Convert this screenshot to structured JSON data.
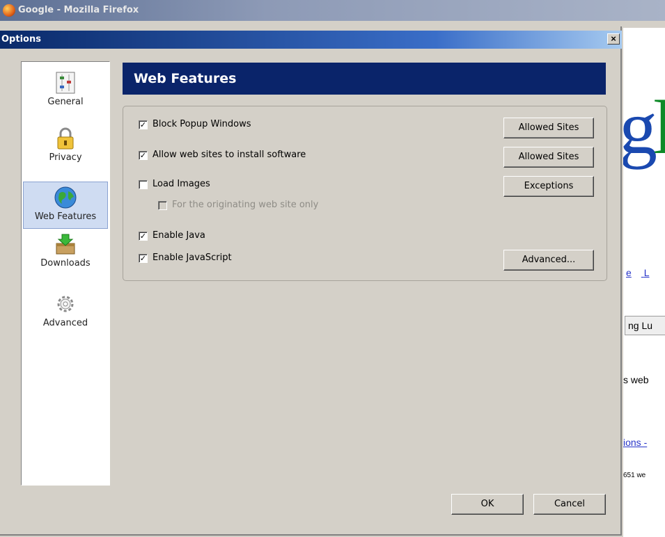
{
  "browser": {
    "window_title": "Google - Mozilla Firefox"
  },
  "background_page": {
    "links": [
      "e",
      "L"
    ],
    "button_text": "ng Lu",
    "text_web": "s web",
    "link_ions": "ions -",
    "small_text": "651 we"
  },
  "dialog": {
    "title": "Options",
    "close_glyph": "×"
  },
  "sidebar": {
    "items": [
      {
        "label": "General",
        "icon": "general-settings-icon",
        "selected": false
      },
      {
        "label": "Privacy",
        "icon": "padlock-icon",
        "selected": false
      },
      {
        "label": "Web Features",
        "icon": "globe-icon",
        "selected": true
      },
      {
        "label": "Downloads",
        "icon": "download-box-icon",
        "selected": false
      },
      {
        "label": "Advanced",
        "icon": "gear-icon",
        "selected": false
      }
    ]
  },
  "panel": {
    "header": "Web Features",
    "options": [
      {
        "label": "Block Popup Windows",
        "checked": true,
        "disabled": false,
        "button": "Allowed Sites"
      },
      {
        "label": "Allow web sites to install software",
        "checked": true,
        "disabled": false,
        "button": "Allowed Sites"
      },
      {
        "label": "Load Images",
        "checked": false,
        "disabled": false,
        "button": "Exceptions"
      },
      {
        "label": "For the originating web site only",
        "checked": false,
        "disabled": true,
        "button": ""
      },
      {
        "label": "Enable Java",
        "checked": true,
        "disabled": false,
        "button": ""
      },
      {
        "label": "Enable JavaScript",
        "checked": true,
        "disabled": false,
        "button": "Advanced..."
      }
    ]
  },
  "footer": {
    "ok_label": "OK",
    "cancel_label": "Cancel"
  },
  "colors": {
    "header_bg": "#0a246a",
    "selected_bg": "#cfdcf2",
    "dialog_bg": "#d4d0c8"
  }
}
